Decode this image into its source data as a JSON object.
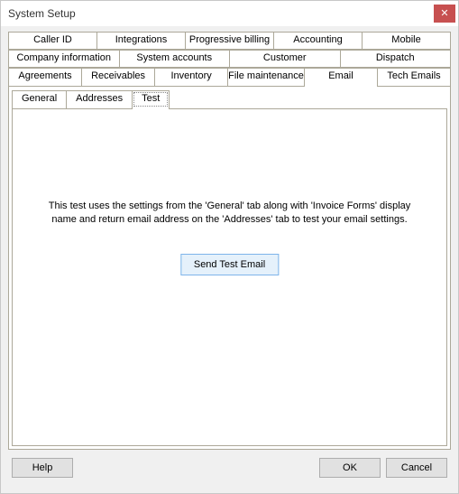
{
  "window": {
    "title": "System Setup"
  },
  "outerTabs": {
    "row1": [
      "Caller ID",
      "Integrations",
      "Progressive billing",
      "Accounting",
      "Mobile"
    ],
    "row2": [
      "Company information",
      "System accounts",
      "Customer",
      "Dispatch"
    ],
    "row3": [
      "Agreements",
      "Receivables",
      "Inventory",
      "File maintenance",
      "Email",
      "Tech Emails"
    ],
    "selected": "Email"
  },
  "innerTabs": {
    "items": [
      "General",
      "Addresses",
      "Test"
    ],
    "selected": "Test"
  },
  "testPanel": {
    "description": "This test uses the settings from the 'General' tab along with 'Invoice Forms' display name and return email address on the 'Addresses' tab to test your email settings.",
    "button": "Send Test Email"
  },
  "footer": {
    "help": "Help",
    "ok": "OK",
    "cancel": "Cancel"
  }
}
